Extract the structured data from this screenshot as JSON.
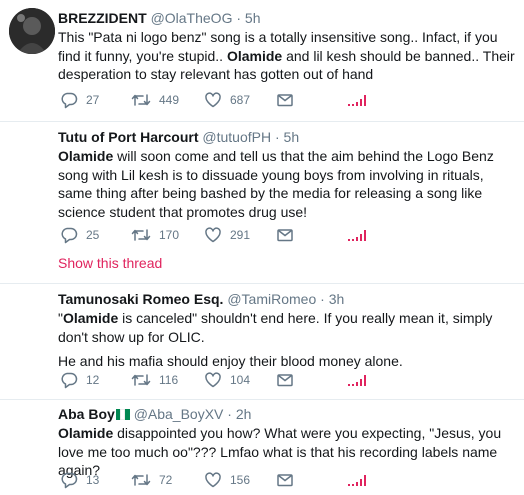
{
  "tweets": [
    {
      "name": "BREZZIDENT",
      "handle": "@OlaTheOG",
      "dot": "·",
      "time": "5h",
      "text": [
        {
          "t": "This \"Pata ni logo benz\" song is a totally insensitive song.. Infact, if you find it funny, you're stupid.. ",
          "b": false
        },
        {
          "t": "Olamide",
          "b": true
        },
        {
          "t": " and lil kesh should be banned.. Their desperation to stay relevant has gotten out of hand",
          "b": false
        }
      ],
      "replies": "27",
      "retweets": "449",
      "likes": "687"
    },
    {
      "name": "Tutu of Port Harcourt",
      "handle": "@tutuofPH",
      "dot": "·",
      "time": "5h",
      "text": [
        {
          "t": "Olamide",
          "b": true
        },
        {
          "t": " will soon come and tell us that the aim behind the Logo Benz song with Lil kesh is to dissuade young boys from involving in rituals, same thing after being bashed by the media for releasing a song like science student that promotes drug use!",
          "b": false
        }
      ],
      "replies": "25",
      "retweets": "170",
      "likes": "291",
      "show_thread": "Show this thread"
    },
    {
      "name": "Tamunosaki Romeo Esq.",
      "handle": "@TamiRomeo",
      "dot": "·",
      "time": "3h",
      "text": [
        {
          "t": "\"",
          "b": false
        },
        {
          "t": "Olamide",
          "b": true
        },
        {
          "t": " is canceled\" shouldn't end here. If you really mean it, simply don't show up for OLIC.",
          "b": false
        }
      ],
      "text2": "He and his mafia should enjoy their blood money alone.",
      "replies": "12",
      "retweets": "116",
      "likes": "104"
    },
    {
      "name": "Aba Boy",
      "handle": "@Aba_BoyXV",
      "dot": "·",
      "time": "2h",
      "text": [
        {
          "t": "Olamide",
          "b": true
        },
        {
          "t": " disappointed you how? What were you expecting, \"Jesus, you love me too much oo\"??? Lmfao what is that his recording labels name again?",
          "b": false
        }
      ],
      "replies": "13",
      "retweets": "72",
      "likes": "156"
    }
  ],
  "icons": {
    "reply": "reply-icon",
    "retweet": "retweet-icon",
    "like": "heart-icon",
    "message": "direct-message-icon",
    "analytics": "analytics-icon"
  },
  "colors": {
    "text": "#14171a",
    "secondary": "#657786",
    "border": "#e6ecf0",
    "show_thread": "#e0245e",
    "analytics": "#e0245e",
    "flag_green": "#008751",
    "flag_white": "#ffffff"
  }
}
